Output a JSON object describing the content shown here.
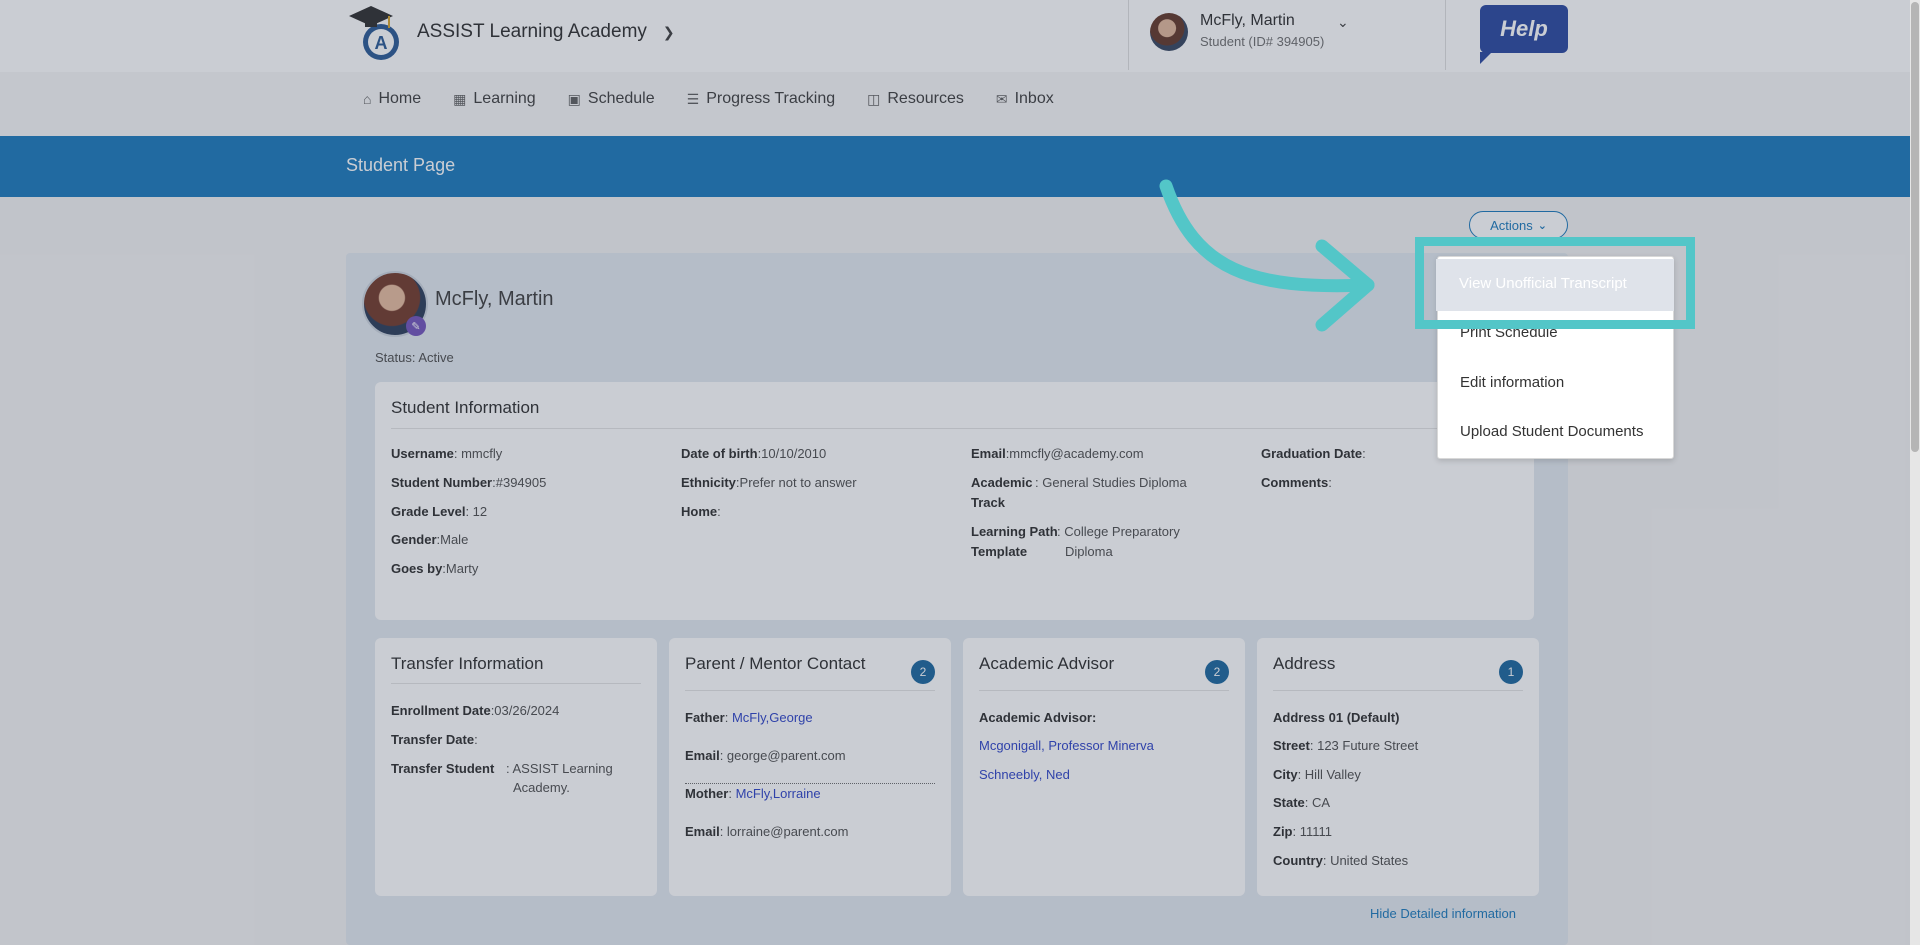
{
  "header": {
    "brand": "ASSIST Learning Academy",
    "user_name": "McFly, Martin",
    "user_id": "Student (ID# 394905)",
    "help": "Help"
  },
  "nav": [
    {
      "label": "Home",
      "icon": "home-icon"
    },
    {
      "label": "Learning",
      "icon": "learning-icon"
    },
    {
      "label": "Schedule",
      "icon": "calendar-icon"
    },
    {
      "label": "Progress Tracking",
      "icon": "progress-icon"
    },
    {
      "label": "Resources",
      "icon": "resources-icon"
    },
    {
      "label": "Inbox",
      "icon": "mail-icon"
    }
  ],
  "banner": {
    "title": "Student Page"
  },
  "actions": {
    "label": "Actions",
    "menu": [
      "View Unofficial Transcript",
      "Print Schedule",
      "Edit information",
      "Upload Student Documents"
    ]
  },
  "profile": {
    "name": "McFly, Martin",
    "status": "Status: Active"
  },
  "student_info": {
    "title": "Student Information",
    "username_label": "Username",
    "username": ": mmcfly",
    "number_label": "Student Number",
    "number": ":#394905",
    "grade_label": "Grade Level",
    "grade": ": 12",
    "gender_label": "Gender",
    "gender": ":Male",
    "goesby_label": "Goes by",
    "goesby": ":Marty",
    "dob_label": "Date of birth",
    "dob": ":10/10/2010",
    "ethnicity_label": "Ethnicity",
    "ethnicity": ":Prefer not to answer",
    "home_label": "Home",
    "home": ":",
    "email_label": "Email",
    "email": ":mmcfly@academy.com",
    "track_label_1": "Academic",
    "track_label_2": "Track",
    "track_1": ": General Studies Diploma",
    "path_label_1": "Learning Path",
    "path_label_2": "Template",
    "path_1": ": College Preparatory",
    "path_2": "Diploma",
    "grad_label": "Graduation Date",
    "grad": ":",
    "comments_label": "Comments",
    "comments": ":"
  },
  "transfer": {
    "title": "Transfer Information",
    "enroll_label": "Enrollment Date",
    "enroll": ":03/26/2024",
    "tdate_label": "Transfer Date",
    "tdate": ":",
    "tstudent_label": "Transfer Student",
    "tstudent_1": ": ASSIST Learning",
    "tstudent_2": "Academy."
  },
  "parents": {
    "title": "Parent / Mentor Contact",
    "count": "2",
    "father_label": "Father",
    "father": "McFly,George",
    "email1_label": "Email",
    "email1": ": george@parent.com",
    "mother_label": "Mother",
    "mother": "McFly,Lorraine",
    "email2_label": "Email",
    "email2": ": lorraine@parent.com"
  },
  "advisor": {
    "title": "Academic Advisor",
    "count": "2",
    "label": "Academic Advisor:",
    "names": [
      "Mcgonigall, Professor Minerva",
      "Schneebly, Ned"
    ]
  },
  "address": {
    "title": "Address",
    "count": "1",
    "heading": "Address 01 (Default)",
    "street_label": "Street",
    "street": ": 123 Future Street",
    "city_label": "City",
    "city": ": Hill Valley",
    "state_label": "State",
    "state": ": CA",
    "zip_label": "Zip",
    "zip": ": 11111",
    "country_label": "Country",
    "country": ": United States"
  },
  "hide_link": "Hide Detailed information",
  "colors": {
    "primary": "#0d72b8",
    "highlight": "#53c6c8",
    "badge": "#0d5d98",
    "link": "#2238c4"
  }
}
